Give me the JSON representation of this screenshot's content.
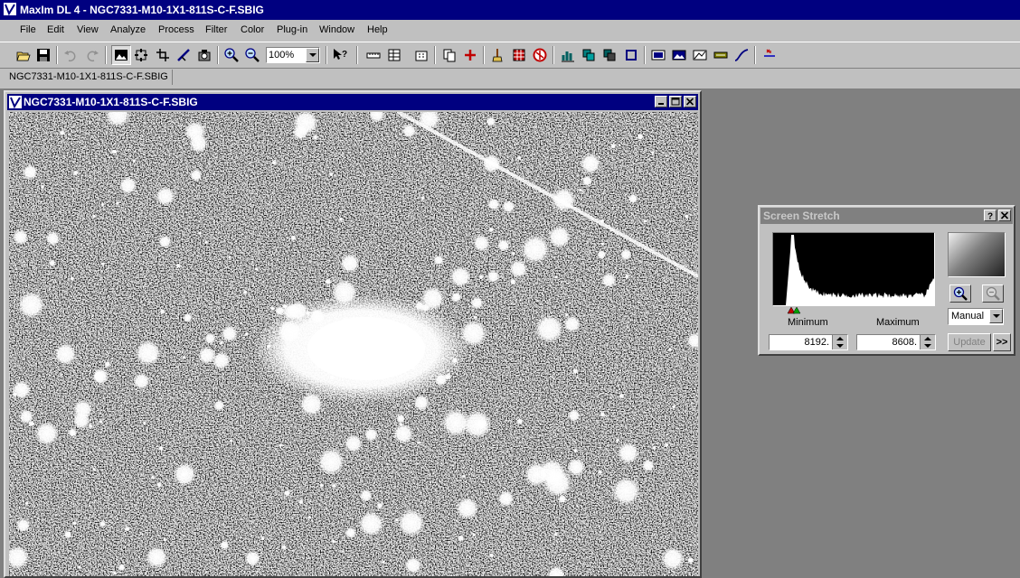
{
  "app": {
    "title": "MaxIm DL 4 - NGC7331-M10-1X1-811S-C-F.SBIG"
  },
  "menu": [
    "File",
    "Edit",
    "View",
    "Analyze",
    "Process",
    "Filter",
    "Color",
    "Plug-in",
    "Window",
    "Help"
  ],
  "toolbar": {
    "zoom_value": "100%"
  },
  "doc_tab": {
    "label": "NGC7331-M10-1X1-811S-C-F.SBIG"
  },
  "image_window": {
    "title": "NGC7331-M10-1X1-811S-C-F.SBIG"
  },
  "screen_stretch": {
    "title": "Screen Stretch",
    "minimum_label": "Minimum",
    "maximum_label": "Maximum",
    "minimum_value": "8192.",
    "maximum_value": "8608.",
    "mode": "Manual",
    "update_label": "Update",
    "more_label": ">>"
  },
  "colors": {
    "title_active": "#000080",
    "title_inactive": "#808080",
    "face": "#c0c0c0",
    "workspace": "#808080"
  }
}
